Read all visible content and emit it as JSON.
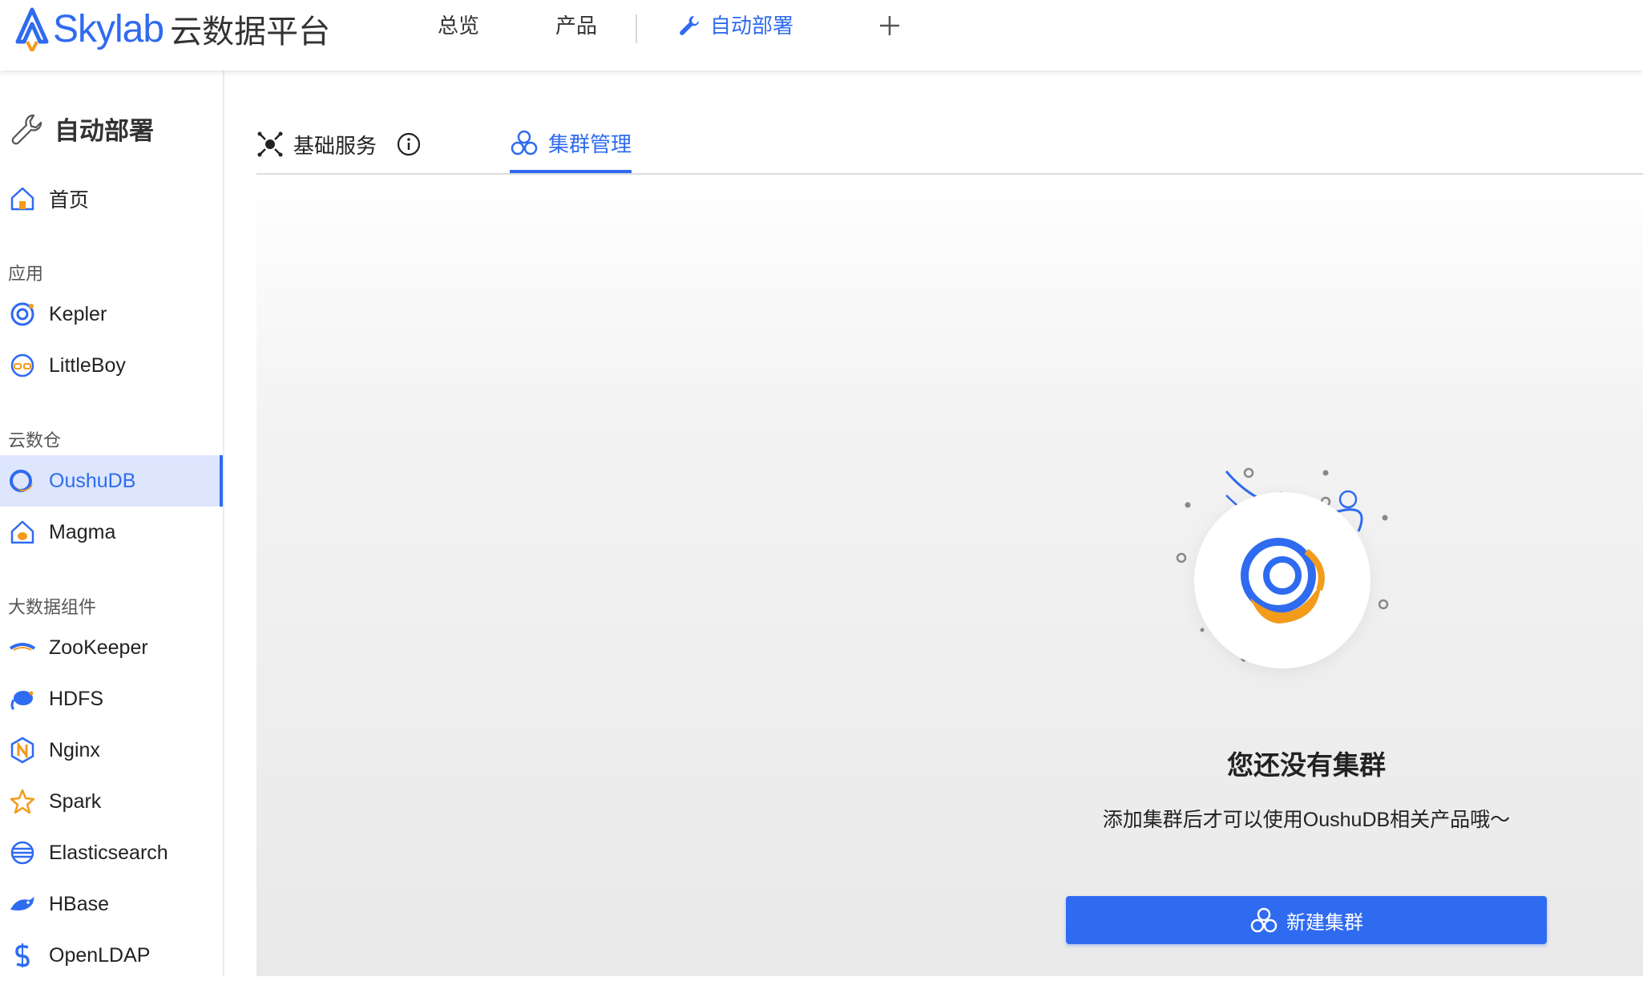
{
  "header": {
    "logo_text": "Skylab",
    "logo_sub": "云数据平台",
    "nav": [
      {
        "label": "总览"
      },
      {
        "label": "产品"
      },
      {
        "label": "自动部署",
        "active": true
      }
    ]
  },
  "sidebar": {
    "title": "自动部署",
    "home": "首页",
    "groups": [
      {
        "label": "应用",
        "items": [
          "Kepler",
          "LittleBoy"
        ]
      },
      {
        "label": "云数仓",
        "items": [
          "OushuDB",
          "Magma"
        ]
      },
      {
        "label": "大数据组件",
        "items": [
          "ZooKeeper",
          "HDFS",
          "Nginx",
          "Spark",
          "Elasticsearch",
          "HBase",
          "OpenLDAP"
        ]
      }
    ],
    "active_item": "OushuDB"
  },
  "tabs": [
    {
      "label": "基础服务"
    },
    {
      "label": "集群管理",
      "active": true
    }
  ],
  "empty_state": {
    "title": "您还没有集群",
    "description": "添加集群后才可以使用OushuDB相关产品哦～",
    "button_label": "新建集群"
  },
  "colors": {
    "accent": "#2f6bf0",
    "active_bg": "#dde6fd",
    "orange": "#f39b1b"
  }
}
